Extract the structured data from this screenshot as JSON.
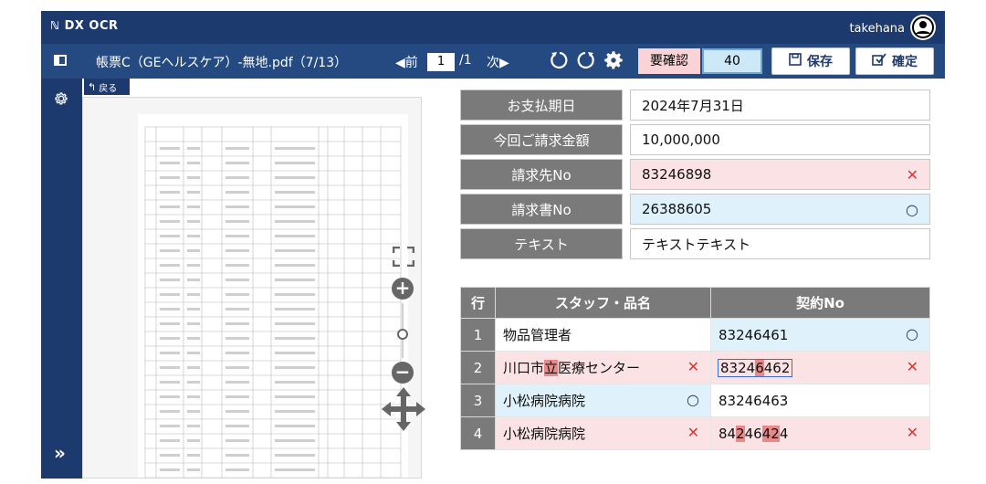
{
  "app": {
    "logo": "DX OCR",
    "user": "takehana"
  },
  "toolbar": {
    "filename": "帳票C（GEヘルスケア）-無地.pdf（7/13）",
    "prev_label": "◀前",
    "page_current": "1",
    "page_total": "/1",
    "next_label": "次▶",
    "needs_check_label": "要確認",
    "needs_check_count": "40",
    "save_label": "保存",
    "confirm_label": "確定"
  },
  "viewer": {
    "back_label": "戻る"
  },
  "fields": [
    {
      "label": "お支払期日",
      "value": "2024年7月31日",
      "status": "none"
    },
    {
      "label": "今回ご請求金額",
      "value": "10,000,000",
      "status": "none"
    },
    {
      "label": "請求先No",
      "value": "83246898",
      "status": "error"
    },
    {
      "label": "請求書No",
      "value": "26388605",
      "status": "ok"
    },
    {
      "label": "テキスト",
      "value": "テキストテキスト",
      "status": "none"
    }
  ],
  "grid": {
    "headers": [
      "行",
      "スタッフ・品名",
      "契約No"
    ],
    "rows": [
      {
        "no": "1",
        "staff_parts": [
          "物品管理者"
        ],
        "contract_parts": [
          "83246461"
        ]
      },
      {
        "no": "2",
        "staff_parts": [
          "川口市",
          "立",
          "医療センター"
        ],
        "contract_parts": [
          "8324",
          "6",
          "462"
        ]
      },
      {
        "no": "3",
        "staff_parts": [
          "小松病院病院"
        ],
        "contract_parts": [
          "83246463"
        ]
      },
      {
        "no": "4",
        "staff_parts": [
          "小松病院病院"
        ],
        "contract_parts": [
          "84",
          "2",
          "46",
          "42",
          "4"
        ]
      }
    ]
  },
  "colors": {
    "navy": "#1d3a6e",
    "error_bg": "#fbe2e4",
    "ok_bg": "#dff1fa",
    "label_gray": "#7a7a7a"
  }
}
